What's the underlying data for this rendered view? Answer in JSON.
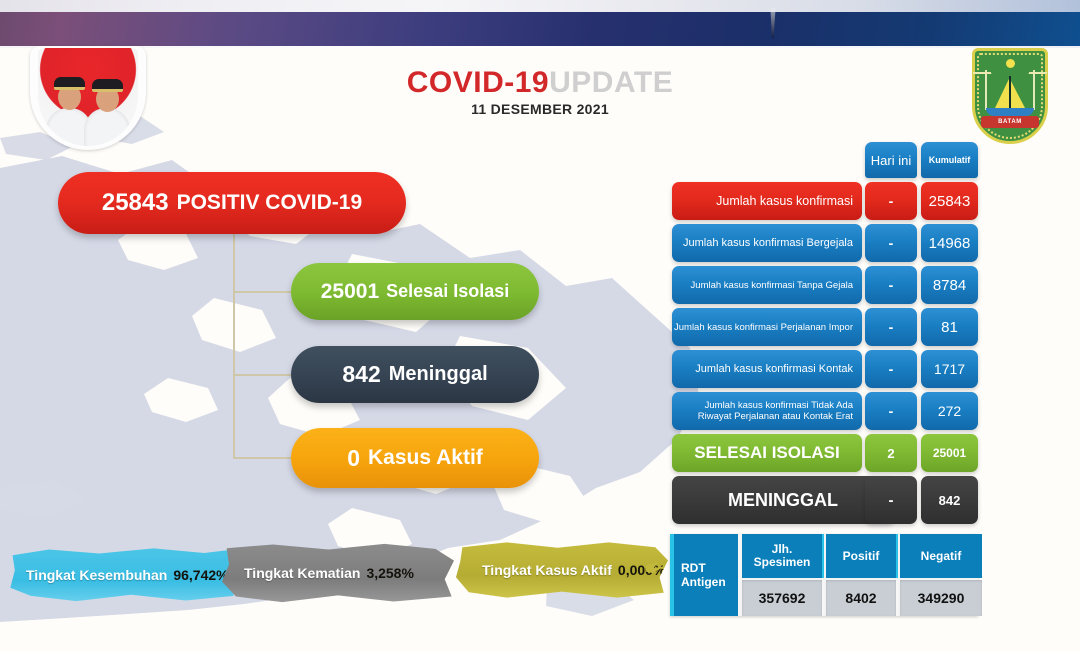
{
  "header": {
    "title_red": "COVID-19",
    "title_grey": "UPDATE",
    "date": "11 DESEMBER 2021",
    "left_badge_name": "officials-photo-badge",
    "right_crest_name": "batam-city-crest",
    "crest_ribbon": "BATAM"
  },
  "summary_cards": [
    {
      "value": "25843",
      "label": "POSITIV COVID-19",
      "color": "#e52a1f",
      "name": "positive"
    },
    {
      "value": "25001",
      "label": "Selesai Isolasi",
      "color": "#80bb33",
      "name": "recovered"
    },
    {
      "value": "842",
      "label": "Meninggal",
      "color": "#364454",
      "name": "deaths"
    },
    {
      "value": "0",
      "label": "Kasus Aktif",
      "color": "#f7a50d",
      "name": "active"
    }
  ],
  "stat_table": {
    "headers": {
      "label": "",
      "today": "Hari ini",
      "cumulative": "Kumulatif"
    },
    "rows": [
      {
        "label": "Jumlah kasus konfirmasi",
        "today": "-",
        "cumulative": "25843",
        "color": "red"
      },
      {
        "label": "Jumlah kasus konfirmasi Bergejala",
        "today": "-",
        "cumulative": "14968",
        "color": "blue"
      },
      {
        "label": "Jumlah kasus konfirmasi Tanpa Gejala",
        "today": "-",
        "cumulative": "8784",
        "color": "blue"
      },
      {
        "label": "Jumlah kasus konfirmasi Perjalanan Impor",
        "today": "-",
        "cumulative": "81",
        "color": "blue"
      },
      {
        "label": "Jumlah kasus konfirmasi Kontak",
        "today": "-",
        "cumulative": "1717",
        "color": "blue"
      },
      {
        "label": "Jumlah kasus konfirmasi Tidak Ada Riwayat Perjalanan atau Kontak Erat",
        "today": "-",
        "cumulative": "272",
        "color": "blue"
      },
      {
        "label": "SELESAI ISOLASI",
        "today": "2",
        "cumulative": "25001",
        "color": "green"
      },
      {
        "label": "MENINGGAL",
        "today": "-",
        "cumulative": "842",
        "color": "dark"
      }
    ]
  },
  "rdt_table": {
    "row_name": "RDT Antigen",
    "columns": [
      "Jlh. Spesimen",
      "Positif",
      "Negatif"
    ],
    "values": [
      "357692",
      "8402",
      "349290"
    ]
  },
  "rates": [
    {
      "label": "Tingkat Kesembuhan",
      "value": "96,742%",
      "color": "#39bde3",
      "name": "recovery-rate"
    },
    {
      "label": "Tingkat Kematian",
      "value": "3,258%",
      "color": "#7c7c7c",
      "name": "death-rate"
    },
    {
      "label": "Tingkat Kasus Aktif",
      "value": "0,000%",
      "color": "#b5ac33",
      "name": "active-rate"
    }
  ],
  "chart_data": {
    "type": "table",
    "title": "COVID-19 UPDATE 11 DESEMBER 2021",
    "categories": [
      "Jumlah kasus konfirmasi",
      "Jumlah kasus konfirmasi Bergejala",
      "Jumlah kasus konfirmasi Tanpa Gejala",
      "Jumlah kasus konfirmasi Perjalanan Impor",
      "Jumlah kasus konfirmasi Kontak",
      "Jumlah kasus konfirmasi Tidak Ada Riwayat Perjalanan atau Kontak Erat",
      "SELESAI ISOLASI",
      "MENINGGAL"
    ],
    "series": [
      {
        "name": "Hari ini",
        "values": [
          null,
          null,
          null,
          null,
          null,
          null,
          2,
          null
        ]
      },
      {
        "name": "Kumulatif",
        "values": [
          25843,
          14968,
          8784,
          81,
          1717,
          272,
          25001,
          842
        ]
      }
    ],
    "secondary_table": {
      "name": "RDT Antigen",
      "columns": [
        "Jlh. Spesimen",
        "Positif",
        "Negatif"
      ],
      "values": [
        357692,
        8402,
        349290
      ]
    },
    "rates": {
      "recovery_pct": 96.742,
      "death_pct": 3.258,
      "active_pct": 0.0
    },
    "xlabel": "",
    "ylabel": "",
    "grid": false,
    "legend": "top"
  }
}
